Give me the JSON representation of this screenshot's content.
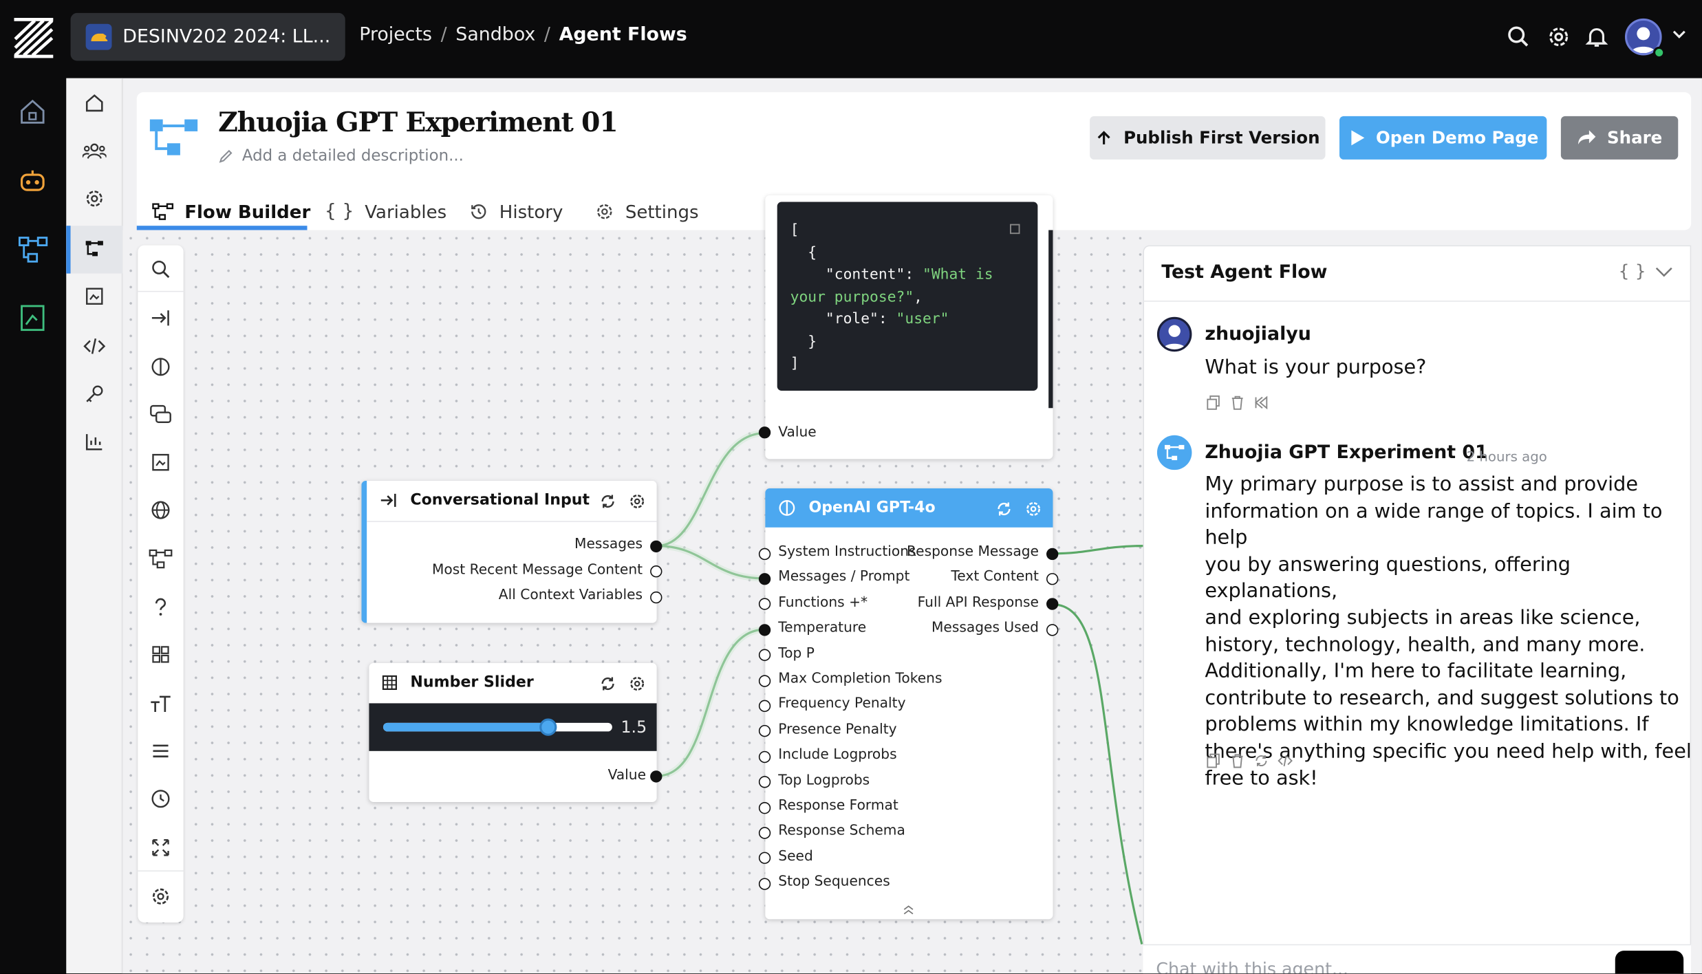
{
  "topbar": {
    "project_name": "DESINV202 2024: LL...",
    "breadcrumb": [
      "Projects",
      "Sandbox",
      "Agent Flows"
    ],
    "icons": [
      "search-icon",
      "gear-icon",
      "bell-icon",
      "avatar",
      "chevron-down-icon"
    ]
  },
  "header": {
    "title": "Zhuojia GPT Experiment 01",
    "description_placeholder": "Add a detailed description...",
    "publish_label": "Publish First Version",
    "demo_label": "Open Demo Page",
    "share_label": "Share"
  },
  "tabs": [
    {
      "label": "Flow Builder",
      "icon": "flow-icon",
      "active": true
    },
    {
      "label": "Variables",
      "icon": "braces-icon"
    },
    {
      "label": "History",
      "icon": "history-icon"
    },
    {
      "label": "Settings",
      "icon": "gear-icon"
    }
  ],
  "code_node": {
    "lines": [
      {
        "t": "["
      },
      {
        "t": "  {"
      },
      {
        "t": "    \"content\": ",
        "s": "\"What is"
      },
      {
        "t": "",
        "s": "your purpose?\"",
        "tail": ","
      },
      {
        "t": "    \"role\": ",
        "s": "\"user\""
      },
      {
        "t": "  }"
      },
      {
        "t": "]"
      }
    ],
    "output_label": "Value"
  },
  "conv_node": {
    "title": "Conversational Input",
    "outputs": [
      "Messages",
      "Most Recent Message Content",
      "All Context Variables"
    ]
  },
  "slider_node": {
    "title": "Number Slider",
    "value": "1.5",
    "fraction": 0.72,
    "output_label": "Value"
  },
  "gpt_node": {
    "title": "OpenAI GPT-4o",
    "inputs": [
      "System Instructions",
      "Messages / Prompt",
      "Functions +*",
      "Temperature",
      "Top P",
      "Max Completion Tokens",
      "Frequency Penalty",
      "Presence Penalty",
      "Include Logprobs",
      "Top Logprobs",
      "Response Format",
      "Response Schema",
      "Seed",
      "Stop Sequences"
    ],
    "outputs": [
      "Response Message",
      "Text Content",
      "Full API Response",
      "Messages Used"
    ]
  },
  "chat": {
    "title": "Test Agent Flow",
    "user_name": "zhuojialyu",
    "user_message": "What is your purpose?",
    "agent_name": "Zhuojia GPT Experiment 01",
    "agent_time": "2 hours ago",
    "agent_lines": [
      "My primary purpose is to assist and provide",
      "information on a wide range of topics. I aim to help",
      "you by answering questions, offering explanations,",
      "and exploring subjects in areas like science,",
      "history, technology, health, and many more.",
      "Additionally, I'm here to facilitate learning,",
      "contribute to research, and suggest solutions to",
      "problems within my knowledge limitations. If",
      "there's anything specific you need help with, feel",
      "free to ask!"
    ],
    "input_placeholder": "Chat with this agent..."
  },
  "colors": {
    "accent": "#4ca8f0",
    "edge": "#5aa866",
    "dark": "#0b0b0c"
  }
}
